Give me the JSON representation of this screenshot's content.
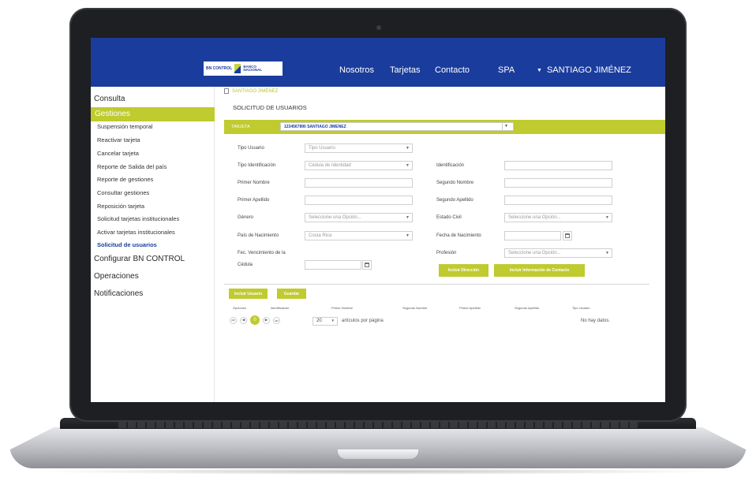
{
  "header": {
    "logo_left": "BN CONTROL",
    "logo_right_top": "BANCO",
    "logo_right_bottom": "NACIONAL",
    "nav": [
      "Nosotros",
      "Tarjetas",
      "Contacto",
      "SPA"
    ],
    "user": "SANTIAGO JIMÉNEZ"
  },
  "sidebar": {
    "consulta": "Consulta",
    "gestiones": "Gestiones",
    "sub_items": [
      "Suspensión temporal",
      "Reactivar tarjeta",
      "Cancelar tarjeta",
      "Reporte de Salida del país",
      "Reporte de gestiones",
      "Consultar gestiones",
      "Reposición tarjeta",
      "Solicitud tarjetas institucionales",
      "Activar tarjetas institucionales",
      "Solicitud de usuarios"
    ],
    "configurar": "Configurar BN CONTROL",
    "operaciones": "Operaciones",
    "notificaciones": "Notificaciones"
  },
  "main": {
    "breadcrumb": "SANTIAGO JIMÉNEZ",
    "title": "SOLICITUD DE USUARIOS",
    "card_label": "TARJETA",
    "card_value": "1234567890 SANTIAGO JIMENEZ",
    "form": {
      "tipo_usuario_label": "Tipo Usuario",
      "tipo_usuario_value": "Tipo Usuario",
      "tipo_identificacion_label": "Tipo Identificación",
      "tipo_identificacion_value": "Cédula de Identidad",
      "identificacion_label": "Identificación",
      "primer_nombre_label": "Primer Nombre",
      "segundo_nombre_label": "Segundo Nombre",
      "primer_apellido_label": "Primer Apellido",
      "segundo_apellido_label": "Segundo Apellido",
      "genero_label": "Género",
      "genero_value": "Seleccione una Opción...",
      "estado_civil_label": "Estado Civil",
      "estado_civil_value": "Seleccione una Opción...",
      "pais_label": "País de Nacimiento",
      "pais_value": "Costa Rica",
      "fecha_label": "Fecha de Nacimiento",
      "vencimiento_label_1": "Fec. Vencimiento de la",
      "vencimiento_label_2": "Cédula",
      "profesion_label": "Profesión",
      "profesion_value": "Seleccione una Opción...",
      "btn_direccion": "Incluir Dirección",
      "btn_contacto": "Incluir Información de Contacto"
    },
    "grid": {
      "btn_incluir": "Incluir Usuario",
      "btn_guardar": "Guardar",
      "columns": [
        "Opciones",
        "Identificación",
        "Primer Nombre",
        "Segundo Nombre",
        "Primer Apellido",
        "Segundo Apellido",
        "Tipo Usuario"
      ],
      "current_page": "0",
      "page_size": "20",
      "per_page_text": "artículos por página",
      "no_data": "No hay datos."
    }
  },
  "colors": {
    "primary_blue": "#1a3c9c",
    "accent_green": "#bfcb2e"
  }
}
